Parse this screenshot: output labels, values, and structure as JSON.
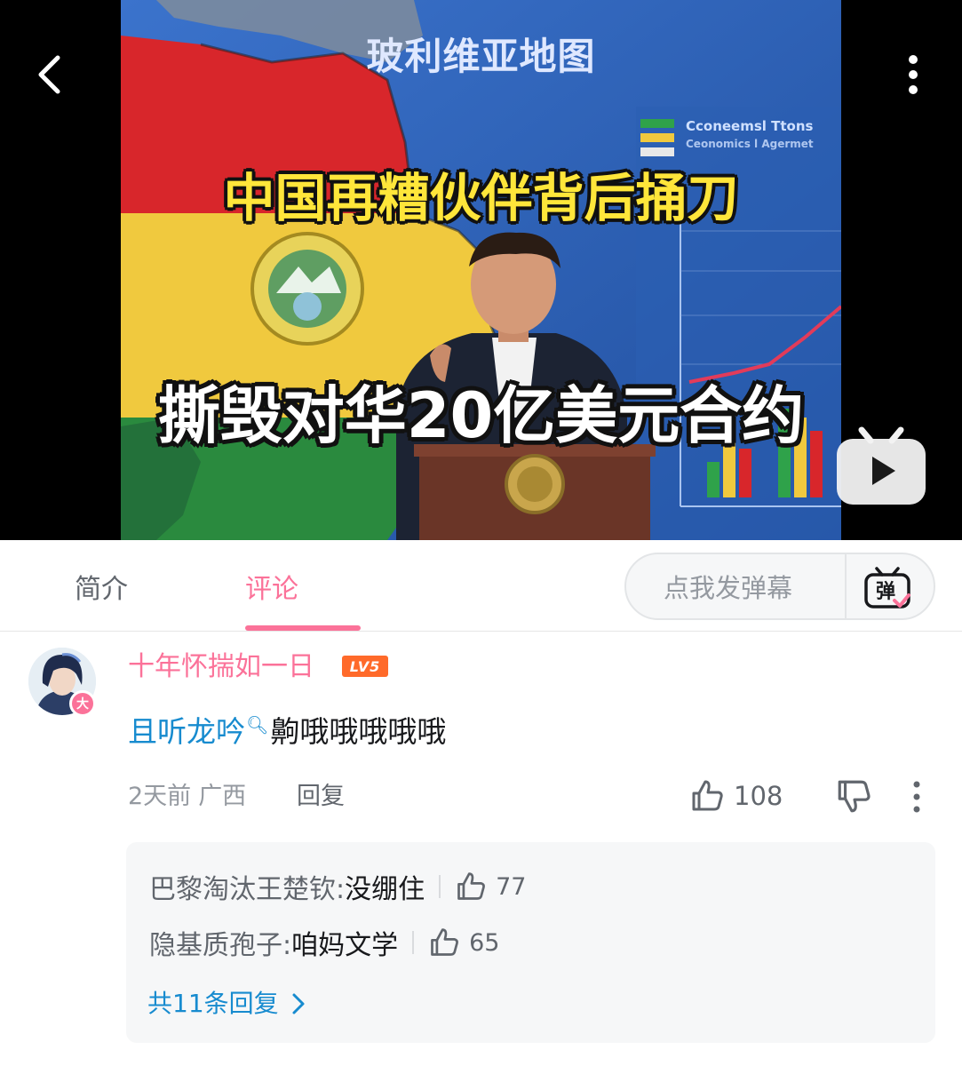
{
  "video": {
    "map_title": "玻利维亚地图",
    "chart_legend_1": "Cconeemsl Ttons",
    "chart_legend_2": "Ceonomics l Agermet",
    "caption_line1": "中国再糟伙伴背后捅刀",
    "caption_line2": "撕毁对华20亿美元合约"
  },
  "tabs": {
    "intro": "简介",
    "comments": "评论",
    "danmaku_placeholder": "点我发弹幕",
    "danmaku_icon_label": "弹"
  },
  "comment": {
    "username": "十年怀揣如一日",
    "level": "LV5",
    "avatar_badge": "大",
    "mention": "且听龙吟",
    "text": "齁哦哦哦哦哦",
    "time": "2天前",
    "location": "广西",
    "reply_label": "回复",
    "likes": "108"
  },
  "replies": {
    "items": [
      {
        "user": "巴黎淘汰王楚钦:",
        "text": "没绷住",
        "likes": "77"
      },
      {
        "user": "隐基质孢子:",
        "text": "咱妈文学",
        "likes": "65"
      }
    ],
    "view_all": "共11条回复"
  },
  "colors": {
    "accent": "#fb7299",
    "link": "#178bcf",
    "level_badge": "#ff6a2a"
  }
}
